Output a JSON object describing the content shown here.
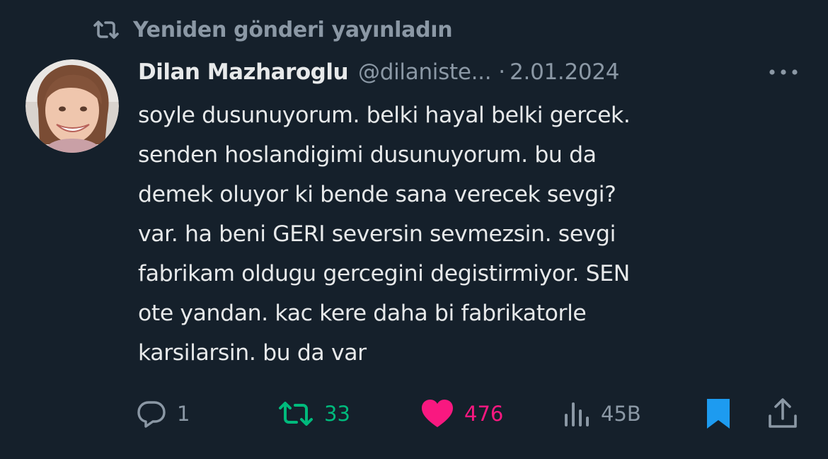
{
  "repost_banner": {
    "text": "Yeniden gönderi yayınladın",
    "icon": "repost-icon"
  },
  "author": {
    "name": "Dilan Mazharoglu",
    "handle": "@dilaniste...",
    "separator": "·",
    "date": "2.01.2024",
    "avatar_icon": "avatar-photo"
  },
  "tweet": {
    "lines": [
      "soyle dusunuyorum. belki hayal belki gercek.",
      "senden hoslandigimi dusunuyorum. bu da",
      "demek oluyor ki bende sana verecek sevgi?",
      "var. ha beni GERI seversin sevmezsin. sevgi",
      "fabrikam oldugu gercegini degistirmiyor. SEN",
      "ote yandan. kac kere daha bi fabrikatorle",
      "karsilarsin. bu da var"
    ]
  },
  "actions": {
    "reply": {
      "icon": "reply-icon",
      "count": "1"
    },
    "repost": {
      "icon": "repost-icon",
      "count": "33"
    },
    "like": {
      "icon": "heart-icon",
      "count": "476"
    },
    "views": {
      "icon": "views-icon",
      "count": "45B"
    },
    "bookmark": {
      "icon": "bookmark-icon"
    },
    "share": {
      "icon": "share-icon"
    }
  },
  "colors": {
    "background": "#15202b",
    "text": "#e7e9ea",
    "muted": "#8b98a5",
    "repost_green": "#00ba7c",
    "like_pink": "#f91880",
    "bookmark_blue": "#1d9bf0"
  }
}
